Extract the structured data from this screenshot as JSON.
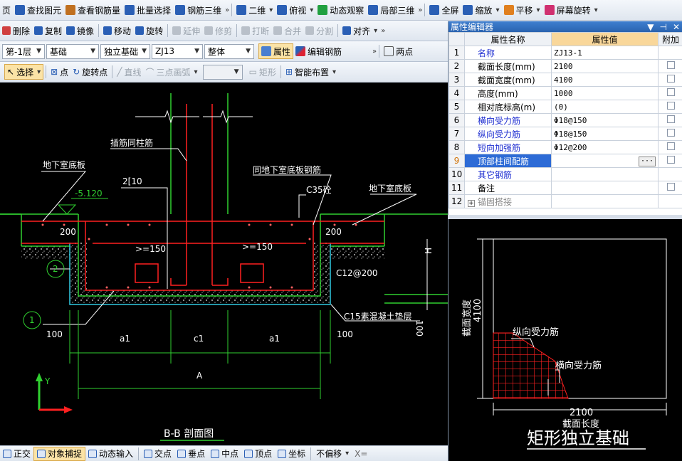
{
  "toolbar1": {
    "items": [
      {
        "label": "页",
        "icon": "page-icon"
      },
      {
        "label": "查找图元",
        "icon": "find-icon"
      },
      {
        "label": "查看钢筋量",
        "icon": "rebar-quantity-icon"
      },
      {
        "label": "批量选择",
        "icon": "batch-select-icon"
      },
      {
        "label": "钢筋三维",
        "icon": "rebar-3d-icon"
      },
      {
        "label": "二维",
        "icon": "2d-icon"
      },
      {
        "label": "俯视",
        "icon": "top-view-icon"
      },
      {
        "label": "动态观察",
        "icon": "orbit-icon"
      },
      {
        "label": "局部三维",
        "icon": "local-3d-icon"
      },
      {
        "label": "全屏",
        "icon": "fullscreen-icon"
      },
      {
        "label": "缩放",
        "icon": "zoom-icon"
      },
      {
        "label": "平移",
        "icon": "pan-icon"
      },
      {
        "label": "屏幕旋转",
        "icon": "screen-rotate-icon"
      }
    ]
  },
  "toolbar2": {
    "items": [
      {
        "label": "删除",
        "icon": "delete-icon",
        "disabled": false
      },
      {
        "label": "复制",
        "icon": "copy-icon",
        "disabled": false
      },
      {
        "label": "镜像",
        "icon": "mirror-icon",
        "disabled": false
      },
      {
        "label": "移动",
        "icon": "move-icon",
        "disabled": false
      },
      {
        "label": "旋转",
        "icon": "rotate-icon",
        "disabled": false
      },
      {
        "label": "延伸",
        "icon": "extend-icon",
        "disabled": true
      },
      {
        "label": "修剪",
        "icon": "trim-icon",
        "disabled": true
      },
      {
        "label": "打断",
        "icon": "break-icon",
        "disabled": true
      },
      {
        "label": "合并",
        "icon": "merge-icon",
        "disabled": true
      },
      {
        "label": "分割",
        "icon": "split-icon",
        "disabled": true
      },
      {
        "label": "对齐",
        "icon": "align-icon",
        "disabled": false
      }
    ]
  },
  "toolbar3": {
    "floor": "第-1层",
    "category": "基础",
    "type": "独立基础",
    "element": "ZJ13",
    "part": "整体",
    "properties_label": "属性",
    "edit_rebar_label": "编辑钢筋",
    "two_points_label": "两点"
  },
  "toolbar4": {
    "select_label": "选择",
    "point_label": "点",
    "rotate_point_label": "旋转点",
    "line_label": "直线",
    "arc_label": "三点画弧",
    "rect_label": "矩形",
    "smart_layout_label": "智能布置"
  },
  "property_editor": {
    "title": "属性编辑器",
    "col_name": "属性名称",
    "col_value": "属性值",
    "col_extra": "附加",
    "rows": [
      {
        "no": "1",
        "name": "名称",
        "value": "ZJ13-1",
        "blue": true,
        "check": false
      },
      {
        "no": "2",
        "name": "截面长度(mm)",
        "value": "2100",
        "blue": false,
        "check": true
      },
      {
        "no": "3",
        "name": "截面宽度(mm)",
        "value": "4100",
        "blue": false,
        "check": true
      },
      {
        "no": "4",
        "name": "高度(mm)",
        "value": "1000",
        "blue": false,
        "check": true
      },
      {
        "no": "5",
        "name": "相对底标高(m)",
        "value": "(0)",
        "blue": false,
        "check": true
      },
      {
        "no": "6",
        "name": "横向受力筋",
        "value": "Φ18@150",
        "blue": true,
        "check": true
      },
      {
        "no": "7",
        "name": "纵向受力筋",
        "value": "Φ18@150",
        "blue": true,
        "check": true
      },
      {
        "no": "8",
        "name": "短向加强筋",
        "value": "Φ12@200",
        "blue": true,
        "check": true
      },
      {
        "no": "9",
        "name": "顶部柱间配筋",
        "value": "",
        "blue": true,
        "check": true,
        "selected": true
      },
      {
        "no": "10",
        "name": "其它钢筋",
        "value": "",
        "blue": true,
        "check": false
      },
      {
        "no": "11",
        "name": "备注",
        "value": "",
        "blue": false,
        "check": true
      },
      {
        "no": "12",
        "name": "锚固搭接",
        "value": "",
        "blue": false,
        "check": false,
        "expand": "+"
      }
    ]
  },
  "section": {
    "title": "B-B 剖面图",
    "labels": {
      "insert_rebar": "插筋同柱筋",
      "basement_slab_left": "地下室底板",
      "basement_slab_right": "地下室底板",
      "same_slab_rebar": "同地下室底板钢筋",
      "concrete": "C35砼",
      "two_bars": "2[10",
      "elevation": "-5.120",
      "min_150_left": ">=150",
      "min_150_right": ">=150",
      "cover_left": "200",
      "cover_right": "200",
      "stirrup": "C12@200",
      "cushion": "C15素混凝土垫层",
      "h_label": "H",
      "dim_100_left": "100",
      "dim_100_right": "100",
      "dim_100_vertical": "100",
      "a1_left": "a1",
      "c1": "c1",
      "a1_right": "a1",
      "total_A": "A",
      "callout_1": "1",
      "callout_2": "2",
      "axis_y": "Y"
    }
  },
  "preview": {
    "width_dim": "4100",
    "width_label": "截面宽度",
    "length_dim": "2100",
    "length_label": "截面长度",
    "long_rebar": "纵向受力筋",
    "trans_rebar": "横向受力筋",
    "caption": "矩形独立基础"
  },
  "statusbar": {
    "items": [
      {
        "label": "正交",
        "on": false
      },
      {
        "label": "对象捕捉",
        "on": true
      },
      {
        "label": "动态输入",
        "on": false
      },
      {
        "label": "交点",
        "on": false
      },
      {
        "label": "垂点",
        "on": false
      },
      {
        "label": "中点",
        "on": false
      },
      {
        "label": "顶点",
        "on": false
      },
      {
        "label": "坐标",
        "on": false
      }
    ],
    "offset_label": "不偏移",
    "x_label": "X="
  },
  "colors": {
    "rebar": "#ff2020",
    "outline": "#30d030",
    "cushion": "#30c8e0",
    "text": "#ffffff",
    "accent": "#2d6bd6"
  }
}
